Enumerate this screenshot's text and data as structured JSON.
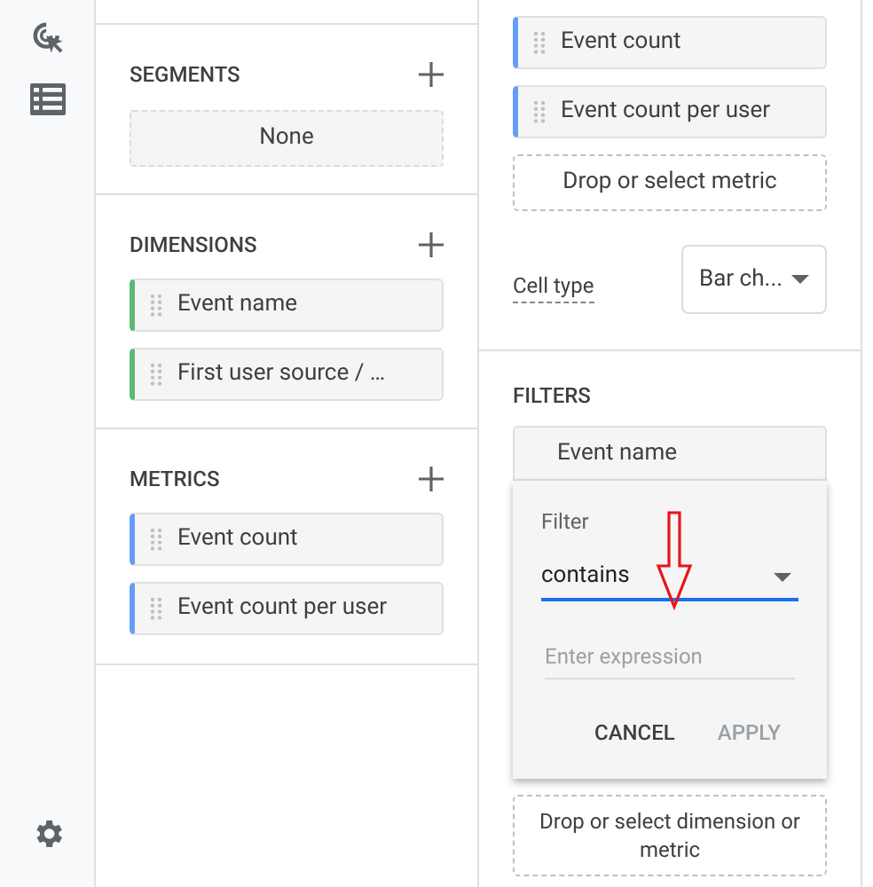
{
  "segments": {
    "title": "SEGMENTS",
    "items": [
      "None"
    ]
  },
  "dimensions": {
    "title": "DIMENSIONS",
    "items": [
      {
        "label": "Event name",
        "kind": "dimension"
      },
      {
        "label": "First user source / …",
        "kind": "dimension"
      }
    ]
  },
  "metrics": {
    "title": "METRICS",
    "items": [
      {
        "label": "Event count",
        "kind": "metric"
      },
      {
        "label": "Event count per user",
        "kind": "metric"
      }
    ]
  },
  "values": {
    "items": [
      {
        "label": "Event count",
        "kind": "metric"
      },
      {
        "label": "Event count per user",
        "kind": "metric"
      }
    ],
    "drop_placeholder": "Drop or select metric",
    "cell_type_label": "Cell type",
    "cell_type_value": "Bar ch..."
  },
  "filters": {
    "title": "FILTERS",
    "chip": "Event name",
    "popup": {
      "label": "Filter",
      "match_type": "contains",
      "expression_placeholder": "Enter expression",
      "buttons": [
        {
          "label": "CANCEL",
          "disabled": false
        },
        {
          "label": "APPLY",
          "disabled": true
        }
      ]
    },
    "drop_placeholder": "Drop or select dimension or metric"
  }
}
